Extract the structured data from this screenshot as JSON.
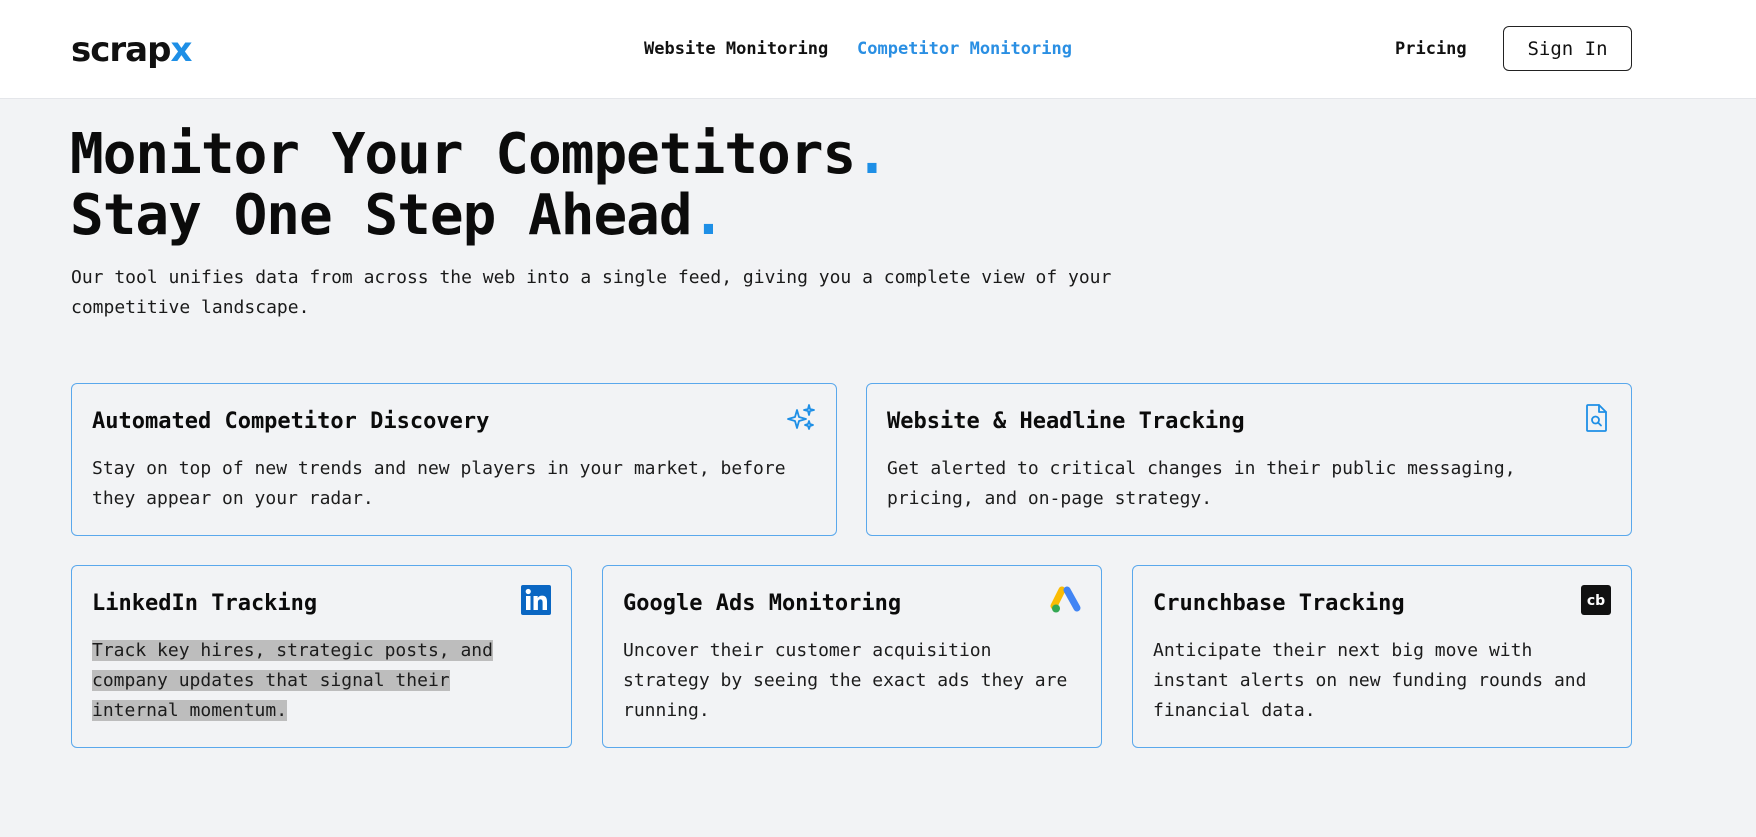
{
  "brand": {
    "logo_main": "scrap",
    "logo_accent": "x",
    "accent_color": "#1e8fe6"
  },
  "nav": {
    "website_monitoring": "Website Monitoring",
    "competitor_monitoring": "Competitor Monitoring",
    "pricing": "Pricing",
    "sign_in": "Sign In"
  },
  "hero": {
    "title_line1": "Monitor Your Competitors",
    "title_line2": "Stay One Step Ahead",
    "dot": ".",
    "subtitle_line1": "Our tool unifies data from across the web into a single feed, giving you a complete view of your",
    "subtitle_line2": "competitive landscape."
  },
  "features": {
    "discovery": {
      "title": "Automated Competitor Discovery",
      "desc_line1": "Stay on top of new trends and new players in your market, before",
      "desc_line2": "they appear on your radar.",
      "icon": "sparkles-icon"
    },
    "website": {
      "title": "Website & Headline Tracking",
      "desc_line1": "Get alerted to critical changes in their public messaging,",
      "desc_line2": "pricing, and on-page strategy.",
      "icon": "document-search-icon"
    },
    "linkedin": {
      "title": "LinkedIn Tracking",
      "desc_line1": "Track key hires, strategic posts, and",
      "desc_line2": "company updates that signal their",
      "desc_line3": "internal momentum.",
      "icon": "linkedin-icon",
      "icon_label": "in"
    },
    "google_ads": {
      "title": "Google Ads Monitoring",
      "desc_line1": "Uncover their customer acquisition",
      "desc_line2": "strategy by seeing the exact ads they are",
      "desc_line3": "running.",
      "icon": "google-ads-icon"
    },
    "crunchbase": {
      "title": "Crunchbase Tracking",
      "desc_line1": "Anticipate their next big move with",
      "desc_line2": "instant alerts on new funding rounds and",
      "desc_line3": "financial data.",
      "icon": "crunchbase-icon",
      "icon_label": "cb"
    }
  }
}
